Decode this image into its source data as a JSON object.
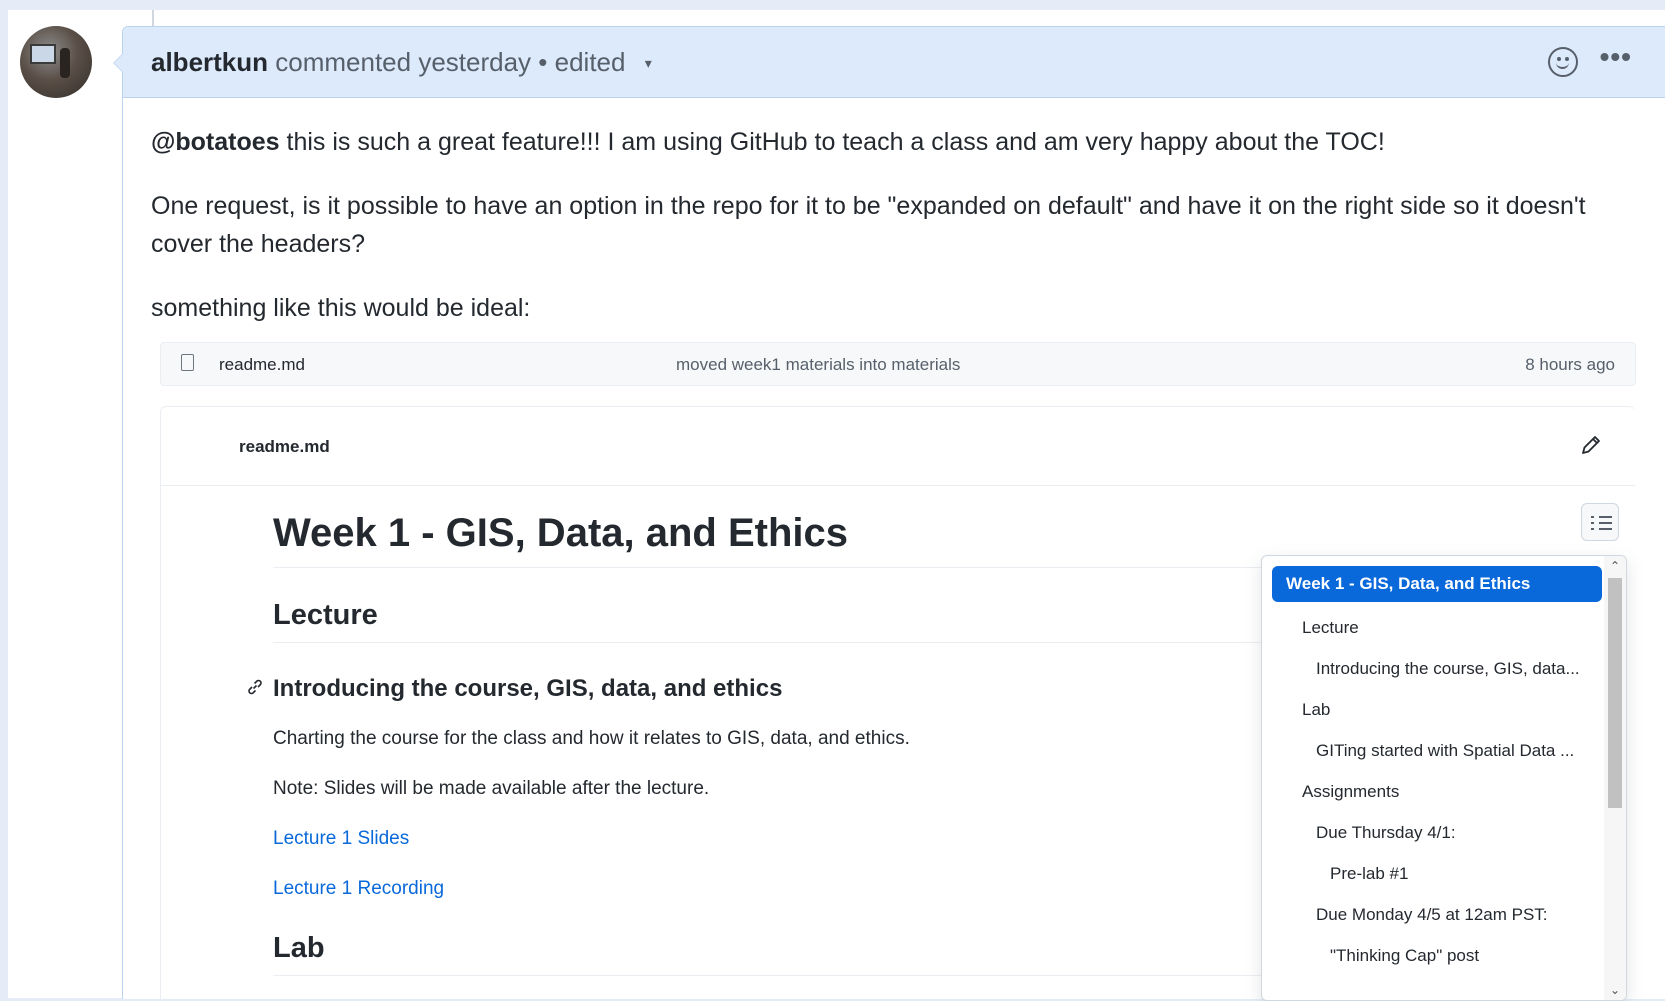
{
  "comment": {
    "author": "albertkun",
    "action": "commented yesterday",
    "separator": "•",
    "edited_label": "edited",
    "dropdown_glyph": "▾",
    "more_glyph": "•••",
    "body": {
      "mention": "@botatoes",
      "paragraph1_rest": " this is such a great feature!!! I am using GitHub to teach a class and am very happy about the TOC!",
      "paragraph2": "One request, is it possible to have an option in the repo for it to be \"expanded on default\" and have it on the right side so it doesn't cover the headers?",
      "paragraph3": "something like this would be ideal:"
    }
  },
  "embedded": {
    "file_row": {
      "file_name": "readme.md",
      "commit_message": "moved week1 materials into materials",
      "age": "8 hours ago"
    },
    "readme": {
      "title": "readme.md",
      "h1": "Week 1 - GIS, Data, and Ethics",
      "h2_lecture": "Lecture",
      "h3_intro": "Introducing the course, GIS, data, and ethics",
      "p_charting": "Charting the course for the class and how it relates to GIS, data, and ethics.",
      "p_note": "Note: Slides will be made available after the lecture.",
      "link_slides": "Lecture 1 Slides",
      "link_recording": "Lecture 1 Recording",
      "h2_lab": "Lab"
    },
    "toc": {
      "items": [
        {
          "label": "Week 1 - GIS, Data, and Ethics"
        },
        {
          "label": "Lecture"
        },
        {
          "label": "Introducing the course, GIS, data..."
        },
        {
          "label": "Lab"
        },
        {
          "label": "GITing started with Spatial Data ..."
        },
        {
          "label": "Assignments"
        },
        {
          "label": "Due Thursday 4/1:"
        },
        {
          "label": "Pre-lab #1"
        },
        {
          "label": "Due Monday 4/5 at 12am PST:"
        },
        {
          "label": "\"Thinking Cap\" post"
        }
      ]
    }
  },
  "colors": {
    "header_bg": "#ddeafc",
    "link": "#0969da",
    "toc_active": "#0969da"
  }
}
